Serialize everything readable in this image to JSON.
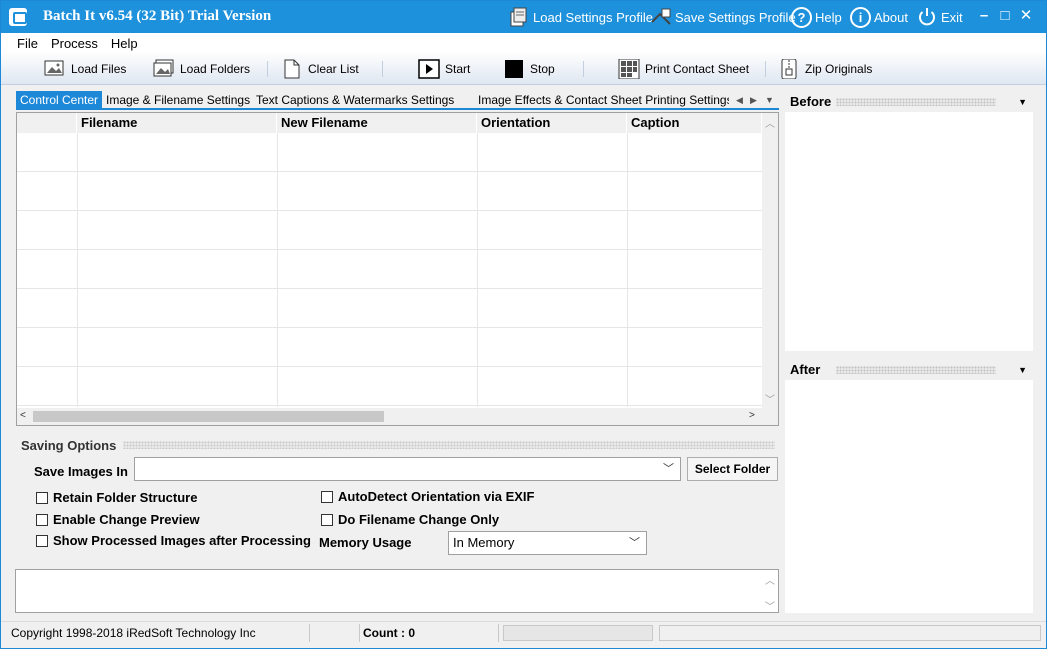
{
  "window": {
    "title": "Batch It v6.54 (32 Bit) Trial Version",
    "accent_color": "#1e91dc"
  },
  "titlebar": {
    "actions": [
      {
        "label": "Load Settings Profile",
        "icon": "load-profile-icon"
      },
      {
        "label": "Save Settings Profile",
        "icon": "save-profile-icon"
      },
      {
        "label": "Help",
        "icon": "help-icon"
      },
      {
        "label": "About",
        "icon": "about-icon"
      },
      {
        "label": "Exit",
        "icon": "power-icon"
      }
    ],
    "controls": {
      "minimize": "–",
      "maximize": "□",
      "close": "✕"
    }
  },
  "menu": [
    "File",
    "Process",
    "Help"
  ],
  "toolbar": {
    "load_files": "Load Files",
    "load_folders": "Load Folders",
    "clear_list": "Clear List",
    "start": "Start",
    "stop": "Stop",
    "print_contact_sheet": "Print Contact Sheet",
    "zip_originals": "Zip Originals"
  },
  "tabs": [
    "Control Center",
    "Image & Filename Settings",
    "Text Captions & Watermarks Settings",
    "Image Effects & Contact Sheet Printing Settings"
  ],
  "active_tab": "Control Center",
  "grid": {
    "columns": [
      "",
      "Filename",
      "New Filename",
      "Orientation",
      "Caption"
    ],
    "rows": []
  },
  "preview": {
    "before": "Before",
    "after": "After"
  },
  "saving_options": {
    "title": "Saving Options",
    "save_images_in_label": "Save Images In",
    "save_images_in_value": "",
    "select_folder": "Select Folder",
    "checkboxes": {
      "retain_folder_structure": {
        "label": "Retain Folder Structure",
        "checked": false
      },
      "enable_change_preview": {
        "label": "Enable Change Preview",
        "checked": false
      },
      "show_processed": {
        "label": "Show Processed Images after Processing",
        "checked": false
      },
      "autodetect_orientation": {
        "label": "AutoDetect Orientation via EXIF",
        "checked": false
      },
      "filename_change_only": {
        "label": "Do Filename Change Only",
        "checked": false
      }
    },
    "memory_usage_label": "Memory Usage",
    "memory_usage_value": "In Memory"
  },
  "statusbar": {
    "copyright": "Copyright 1998-2018 iRedSoft Technology Inc",
    "count": "Count : 0"
  }
}
